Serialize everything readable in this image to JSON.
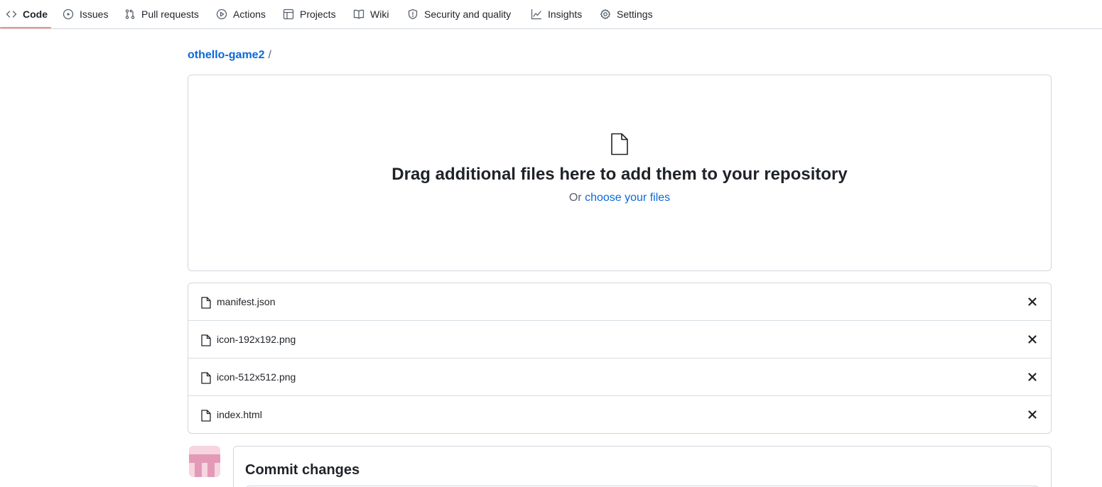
{
  "nav": {
    "tabs": [
      {
        "label": "Code",
        "icon": "code-icon",
        "active": true
      },
      {
        "label": "Issues",
        "icon": "issue-opened-icon"
      },
      {
        "label": "Pull requests",
        "icon": "git-pull-request-icon"
      },
      {
        "label": "Actions",
        "icon": "play-icon"
      },
      {
        "label": "Projects",
        "icon": "table-icon"
      },
      {
        "label": "Wiki",
        "icon": "book-icon"
      },
      {
        "label": "Security and quality",
        "icon": "shield-icon"
      },
      {
        "label": "Insights",
        "icon": "graph-icon"
      },
      {
        "label": "Settings",
        "icon": "gear-icon"
      }
    ],
    "active_color": "#fd8c73"
  },
  "breadcrumb": {
    "repo": "othello-game2",
    "separator": "/"
  },
  "dropzone": {
    "title": "Drag additional files here to add them to your repository",
    "prefix": "Or",
    "link": "choose your files",
    "icon": "file-icon"
  },
  "files": [
    {
      "name": "manifest.json"
    },
    {
      "name": "icon-192x192.png"
    },
    {
      "name": "icon-512x512.png"
    },
    {
      "name": "index.html"
    }
  ],
  "commit": {
    "title": "Commit changes"
  },
  "colors": {
    "link": "#0969da",
    "border": "#d0d7de",
    "text": "#1f2328",
    "muted": "#59636e"
  }
}
